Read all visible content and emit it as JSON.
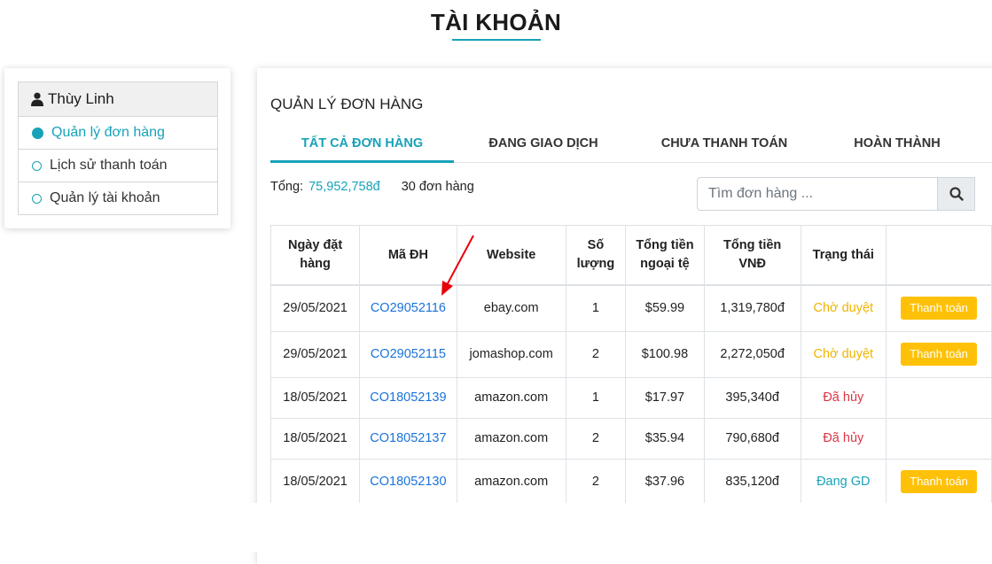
{
  "page": {
    "title": "TÀI KHOẢN"
  },
  "sidebar": {
    "user_name": "Thùy Linh",
    "items": [
      {
        "label": "Quản lý đơn hàng",
        "active": true
      },
      {
        "label": "Lịch sử thanh toán",
        "active": false
      },
      {
        "label": "Quản lý tài khoản",
        "active": false
      }
    ]
  },
  "main": {
    "section_title": "QUẢN LÝ ĐƠN HÀNG",
    "tabs": [
      {
        "label": "TẤT CẢ ĐƠN HÀNG"
      },
      {
        "label": "ĐANG GIAO DỊCH"
      },
      {
        "label": "CHƯA THANH TOÁN"
      },
      {
        "label": "HOÀN THÀNH"
      }
    ],
    "summary": {
      "total_label": "Tổng:",
      "total_amount": "75,952,758đ",
      "order_count": "30 đơn hàng"
    },
    "search": {
      "placeholder": "Tìm đơn hàng ..."
    },
    "table": {
      "headers": {
        "date_line1": "Ngày đặt",
        "date_line2": "hàng",
        "code": "Mã ĐH",
        "website": "Website",
        "qty_line1": "Số",
        "qty_line2": "lượng",
        "foreign_line1": "Tổng tiền",
        "foreign_line2": "ngoại tệ",
        "vnd_line1": "Tổng tiền",
        "vnd_line2": "VNĐ",
        "status": "Trạng thái"
      },
      "rows": [
        {
          "date": "29/05/2021",
          "code": "CO29052116",
          "website": "ebay.com",
          "qty": "1",
          "foreign": "$59.99",
          "vnd": "1,319,780đ",
          "status": "Chờ duyệt",
          "action": "Thanh toán"
        },
        {
          "date": "29/05/2021",
          "code": "CO29052115",
          "website": "jomashop.com",
          "qty": "2",
          "foreign": "$100.98",
          "vnd": "2,272,050đ",
          "status": "Chờ duyệt",
          "action": "Thanh toán"
        },
        {
          "date": "18/05/2021",
          "code": "CO18052139",
          "website": "amazon.com",
          "qty": "1",
          "foreign": "$17.97",
          "vnd": "395,340đ",
          "status": "Đã hủy",
          "action": ""
        },
        {
          "date": "18/05/2021",
          "code": "CO18052137",
          "website": "amazon.com",
          "qty": "2",
          "foreign": "$35.94",
          "vnd": "790,680đ",
          "status": "Đã hủy",
          "action": ""
        },
        {
          "date": "18/05/2021",
          "code": "CO18052130",
          "website": "amazon.com",
          "qty": "2",
          "foreign": "$37.96",
          "vnd": "835,120đ",
          "status": "Đang GD",
          "action": "Thanh toán"
        }
      ]
    }
  },
  "colors": {
    "accent": "#17a2b8",
    "link": "#1a73d9",
    "warning": "#ffc107",
    "danger": "#dc3545",
    "annotation": "#e8000b"
  },
  "icons": {
    "user": "user-icon",
    "search": "search-icon"
  }
}
